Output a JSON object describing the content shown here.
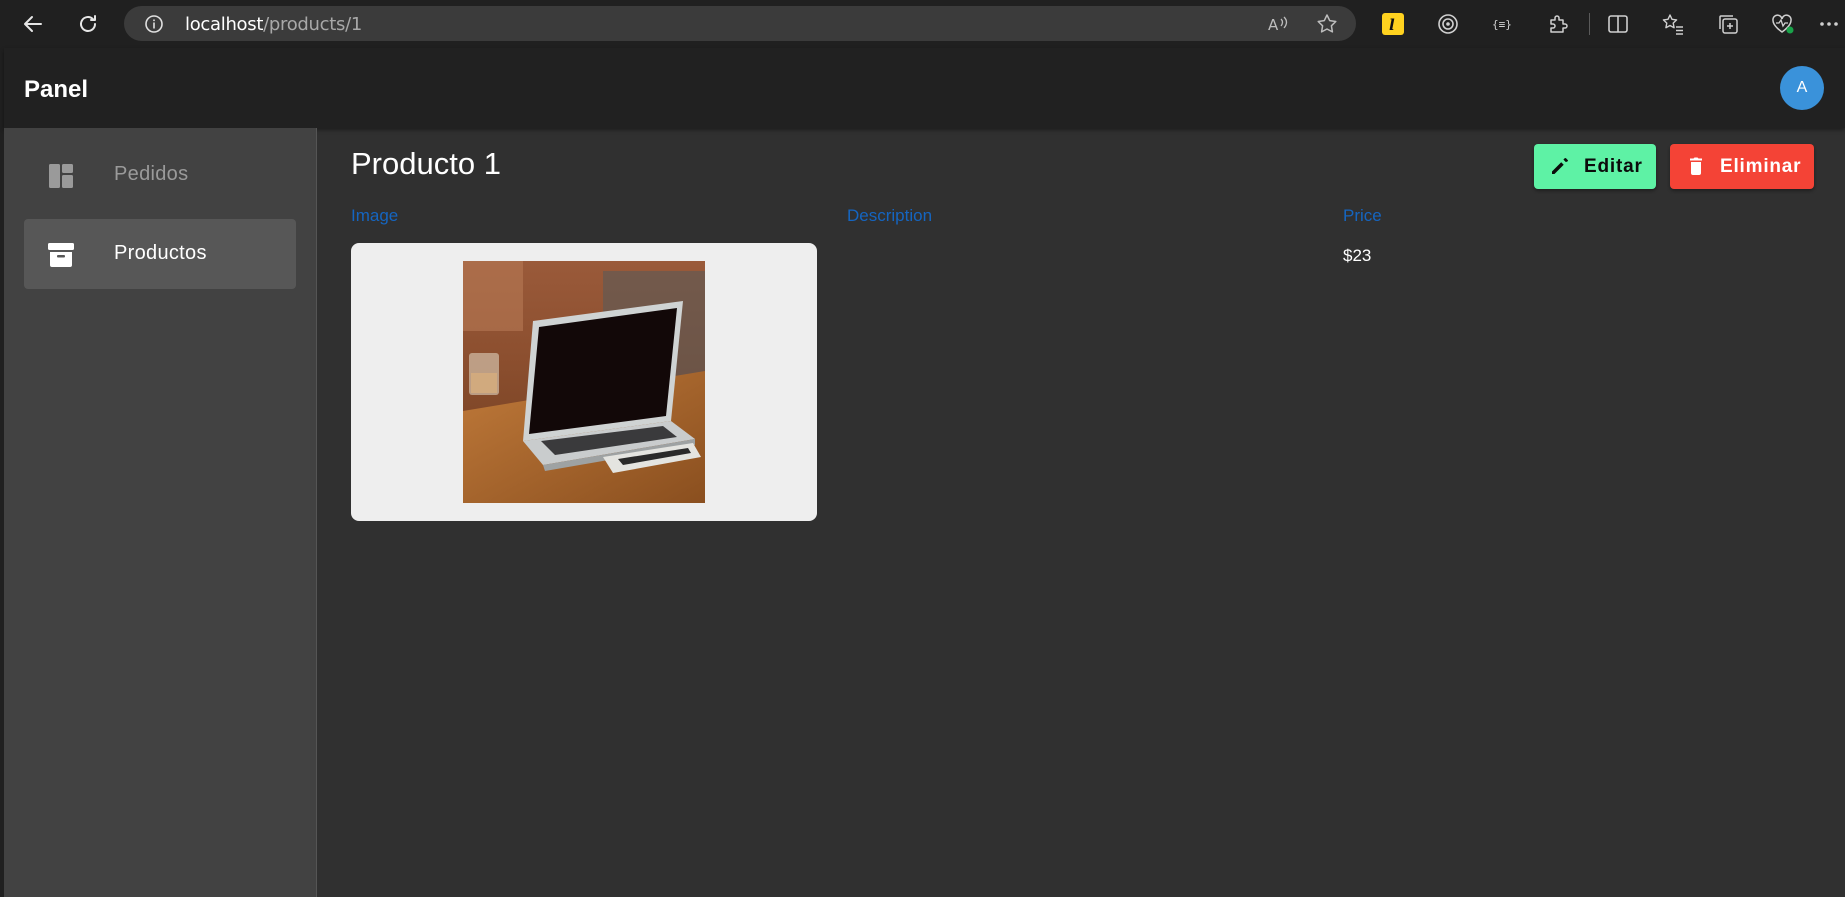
{
  "browser": {
    "url_host": "localhost",
    "url_path": "/products/1"
  },
  "app": {
    "title": "Panel",
    "avatar_initial": "A"
  },
  "sidebar": {
    "items": [
      {
        "label": "Pedidos",
        "icon": "dashboard-icon",
        "active": false
      },
      {
        "label": "Productos",
        "icon": "archive-icon",
        "active": true
      }
    ]
  },
  "product": {
    "title": "Producto 1",
    "columns": {
      "image": "Image",
      "description": "Description",
      "price": "Price"
    },
    "description": "",
    "price": "$23"
  },
  "actions": {
    "edit_label": "Editar",
    "delete_label": "Eliminar"
  },
  "colors": {
    "edit_button": "#5ef2a5",
    "delete_button": "#f44336",
    "column_header": "#1565c0",
    "avatar": "#3a92da"
  }
}
